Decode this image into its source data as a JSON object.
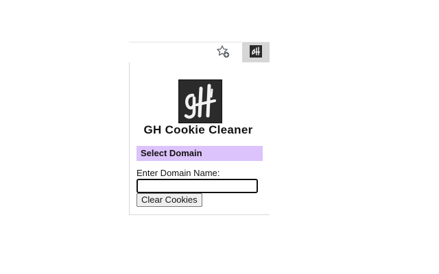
{
  "browser": {
    "bookmark_icon": "star-plus-icon",
    "extension_icon": "gh-cookie-cleaner-icon"
  },
  "popup": {
    "logo_icon": "gh-logo",
    "title": "GH Cookie Cleaner",
    "section_header": "Select Domain",
    "field_label": "Enter Domain Name:",
    "domain_input_value": "",
    "domain_input_placeholder": "",
    "clear_button_label": "Clear Cookies"
  },
  "colors": {
    "section_header_bg": "#dcc3fb",
    "logo_bg": "#2b2b2b",
    "extension_button_bg": "#d6d6d6"
  }
}
